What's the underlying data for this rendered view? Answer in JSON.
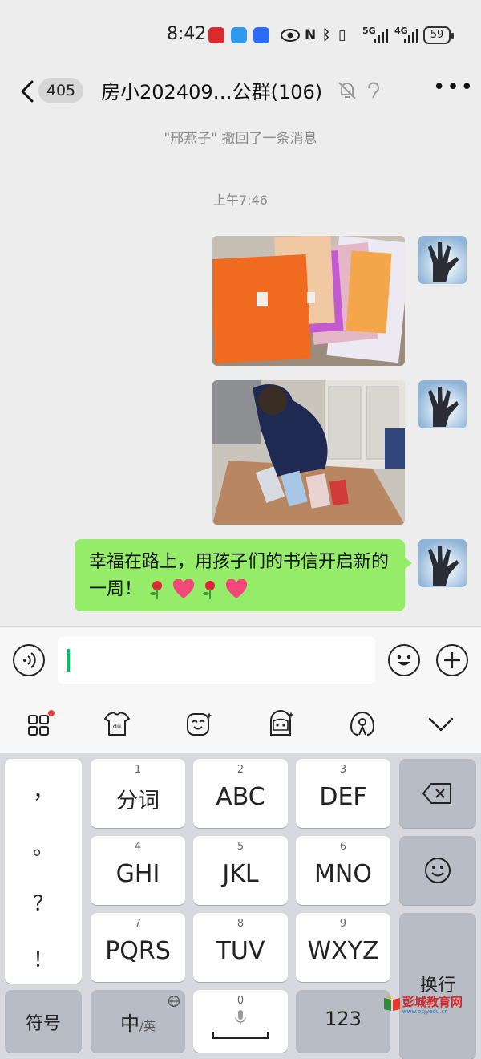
{
  "status_bar": {
    "time": "8:42",
    "signal_labels": [
      "5G",
      "4G"
    ],
    "battery": "59"
  },
  "nav": {
    "unread_count": "405",
    "title": "房小202409…公群(106)",
    "more_label": "•••"
  },
  "chat": {
    "system_notice": "\"邢燕子\" 撤回了一条消息",
    "timestamp": "上午7:46",
    "messages": [
      {
        "type": "image",
        "description": "envelopes"
      },
      {
        "type": "image",
        "description": "student"
      },
      {
        "type": "text",
        "text": "幸福在路上，用孩子们的书信开启新的一周！"
      }
    ],
    "emojis": [
      "rose",
      "heart",
      "rose",
      "heart"
    ]
  },
  "input": {
    "value": "",
    "placeholder": ""
  },
  "ime_toolbar": {
    "icons": [
      "apps-icon",
      "skin-icon",
      "emoticon-icon",
      "sticker-icon",
      "handwrite-icon",
      "collapse-icon"
    ]
  },
  "keyboard": {
    "left_column": [
      "，",
      "。",
      "？",
      "！"
    ],
    "keys": [
      {
        "num": "1",
        "label": "分词"
      },
      {
        "num": "2",
        "label": "ABC"
      },
      {
        "num": "3",
        "label": "DEF"
      },
      {
        "num": "4",
        "label": "GHI"
      },
      {
        "num": "5",
        "label": "JKL"
      },
      {
        "num": "6",
        "label": "MNO"
      },
      {
        "num": "7",
        "label": "PQRS"
      },
      {
        "num": "8",
        "label": "TUV"
      },
      {
        "num": "9",
        "label": "WXYZ"
      }
    ],
    "symbol_key": "符号",
    "lang_key_main": "中",
    "lang_key_sub": "/英",
    "space_num": "0",
    "numeric_key": "123",
    "enter_key": "换行"
  },
  "watermark": {
    "text": "彭城教育网",
    "url": "www.pcjyedu.cn"
  },
  "colors": {
    "bubble": "#95ec69",
    "background": "#ededed",
    "caret": "#07c160",
    "keyboard_bg": "#d7d9de"
  }
}
